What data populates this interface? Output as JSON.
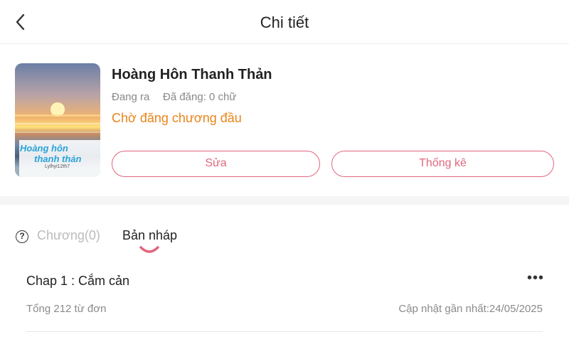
{
  "header": {
    "title": "Chi tiết",
    "back_icon": "chevron-left-icon"
  },
  "book": {
    "cover": {
      "title_line1": "Hoàng hôn",
      "title_line2": "thanh thản",
      "author_mark": "Lylhyi12th7"
    },
    "title": "Hoàng Hôn Thanh Thản",
    "status": "Đang ra",
    "posted": "Đã đăng: 0 chữ",
    "waiting": "Chờ đăng chương đầu",
    "edit_label": "Sửa",
    "stats_label": "Thống kê"
  },
  "tabs": {
    "help_icon": "question-circle-icon",
    "items": [
      {
        "label": "Chương(0)",
        "active": false
      },
      {
        "label": "Bản nháp",
        "active": true
      }
    ]
  },
  "drafts": [
    {
      "title": "Chap 1 : Cắm cản",
      "words": "Tổng 212 từ đơn",
      "updated": "Cập nhật gần nhất:24/05/2025",
      "more_icon": "more-dots-icon"
    }
  ],
  "colors": {
    "accent": "#e0677d",
    "warning": "#e8851a"
  }
}
